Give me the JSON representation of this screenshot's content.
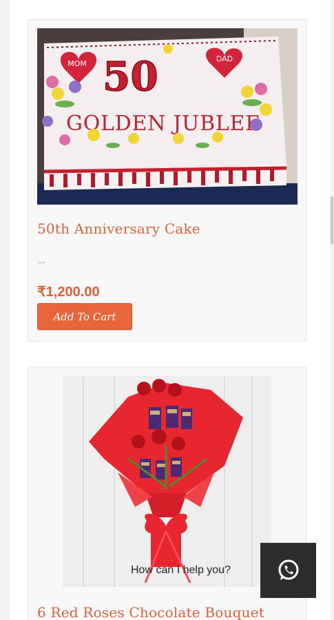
{
  "products": [
    {
      "title": "50th Anniversary Cake",
      "excerpt": "...",
      "price": "₹1,200.00",
      "button_label": "Add To Cart",
      "image_text": {
        "heart_left": "MOM",
        "heart_right": "DAD",
        "number": "50",
        "message": "GOLDEN JUBLEE"
      }
    },
    {
      "title": "6 Red Roses Chocolate Bouquet"
    }
  ],
  "chat": {
    "prompt": "How can I help you?",
    "icon": "whatsapp-icon"
  },
  "colors": {
    "accent": "#d9623b",
    "button": "#e8663c",
    "chat_bg": "#2d2d2d"
  }
}
